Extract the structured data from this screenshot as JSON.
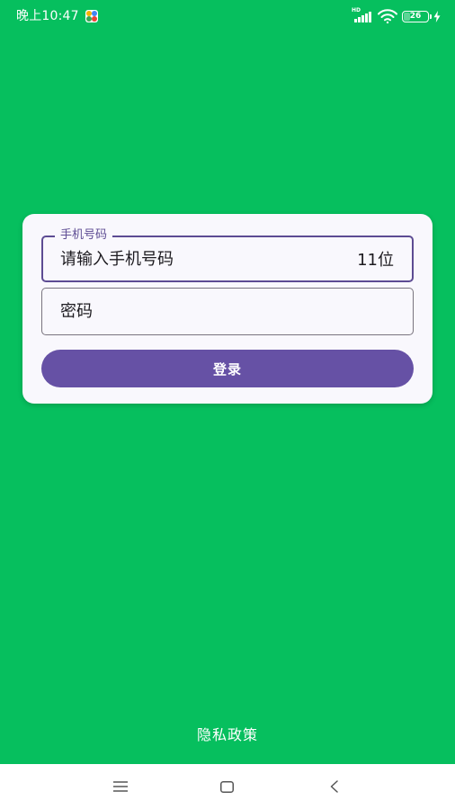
{
  "status_bar": {
    "time": "晚上10:47",
    "network_label": "HD",
    "battery_percent": "26",
    "battery_level": 0.26
  },
  "login_form": {
    "phone_label": "手机号码",
    "phone_placeholder": "请输入手机号码",
    "phone_suffix": "11位",
    "password_placeholder": "密码",
    "submit_label": "登录"
  },
  "footer": {
    "privacy_label": "隐私政策"
  },
  "colors": {
    "background": "#06BF5E",
    "accent": "#6651A5",
    "field_border_focused": "#5D4C93",
    "card": "#F9F8FD"
  },
  "nav_icons": [
    "menu-icon",
    "home-icon",
    "back-icon"
  ]
}
